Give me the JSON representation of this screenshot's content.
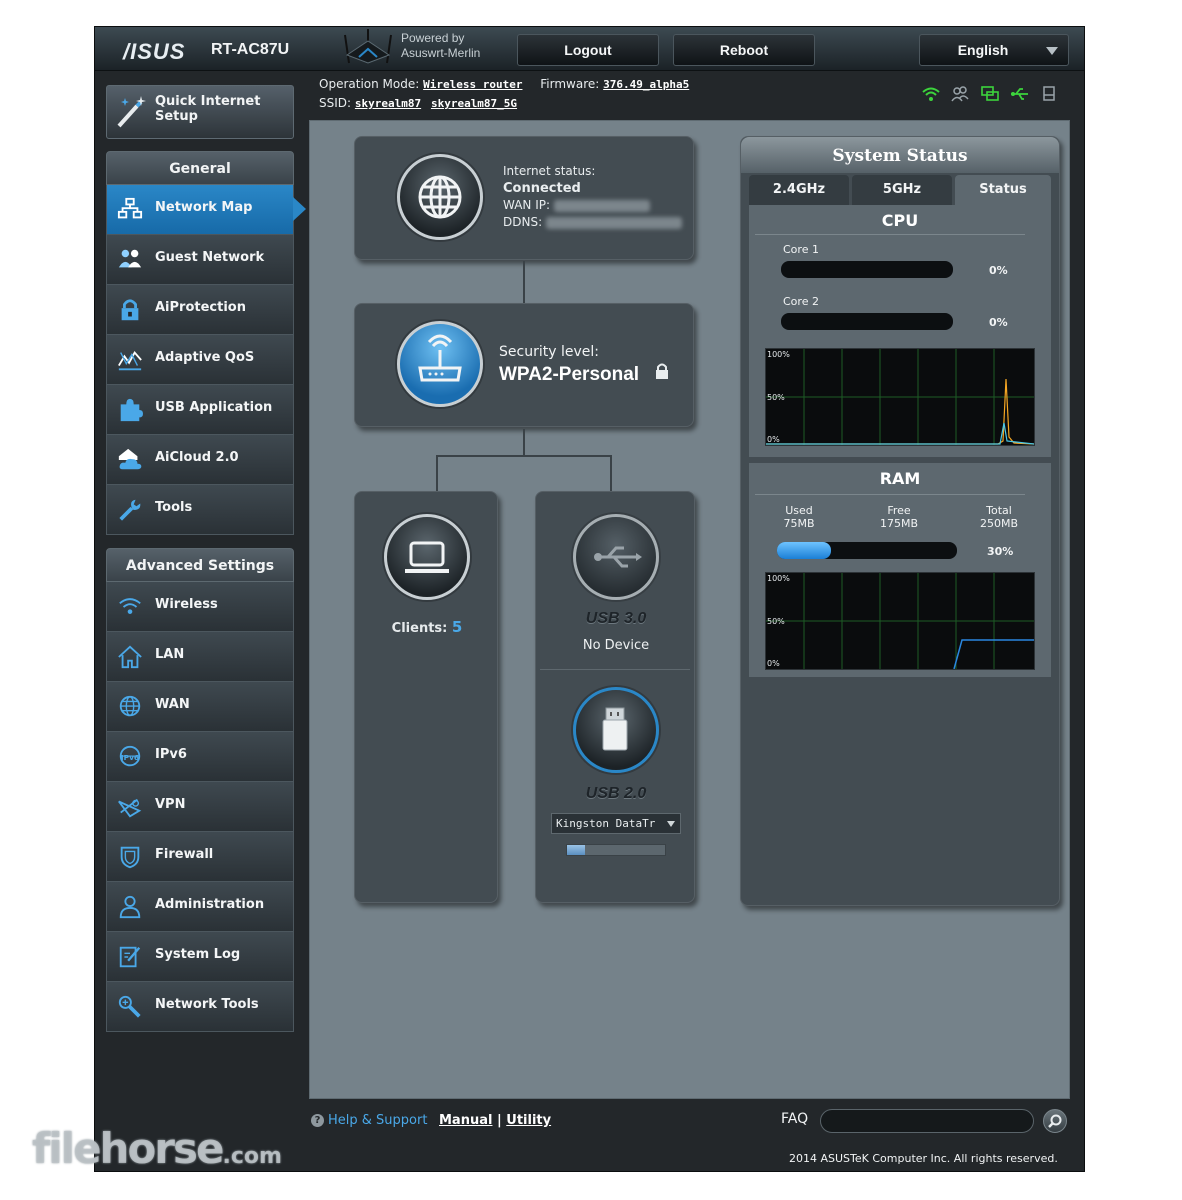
{
  "header": {
    "brand": "/ISUS",
    "model": "RT-AC87U",
    "powered_by": "Powered by",
    "firmware_name": "Asuswrt-Merlin",
    "logout_label": "Logout",
    "reboot_label": "Reboot",
    "language": "English"
  },
  "info": {
    "operation_mode_label": "Operation Mode:",
    "operation_mode": "Wireless router",
    "firmware_label": "Firmware:",
    "firmware": "376.49_alpha5",
    "ssid_label": "SSID:",
    "ssid_1": "skyrealm87",
    "ssid_2": "skyrealm87_5G"
  },
  "status_icons": [
    "wifi-icon",
    "clients-icon",
    "network-icon",
    "usb-icon",
    "printer-icon"
  ],
  "sidebar": {
    "quick_setup": "Quick Internet Setup",
    "general_title": "General",
    "general_items": [
      {
        "label": "Network Map",
        "icon": "network-map-icon"
      },
      {
        "label": "Guest Network",
        "icon": "guest-network-icon"
      },
      {
        "label": "AiProtection",
        "icon": "lock-icon"
      },
      {
        "label": "Adaptive QoS",
        "icon": "qos-icon"
      },
      {
        "label": "USB Application",
        "icon": "puzzle-icon"
      },
      {
        "label": "AiCloud 2.0",
        "icon": "cloud-icon"
      },
      {
        "label": "Tools",
        "icon": "wrench-icon"
      }
    ],
    "advanced_title": "Advanced Settings",
    "advanced_items": [
      {
        "label": "Wireless",
        "icon": "wireless-icon"
      },
      {
        "label": "LAN",
        "icon": "home-icon"
      },
      {
        "label": "WAN",
        "icon": "globe-icon"
      },
      {
        "label": "IPv6",
        "icon": "ipv6-icon"
      },
      {
        "label": "VPN",
        "icon": "vpn-icon"
      },
      {
        "label": "Firewall",
        "icon": "shield-icon"
      },
      {
        "label": "Administration",
        "icon": "user-icon"
      },
      {
        "label": "System Log",
        "icon": "log-icon"
      },
      {
        "label": "Network Tools",
        "icon": "tools-icon"
      }
    ]
  },
  "network_map": {
    "internet_status_label": "Internet status:",
    "internet_status": "Connected",
    "wan_ip_label": "WAN IP:",
    "ddns_label": "DDNS:",
    "security_label": "Security level:",
    "security_value": "WPA2-Personal",
    "clients_label": "Clients:",
    "clients_count": "5",
    "usb3_title": "USB 3.0",
    "usb3_status": "No Device",
    "usb2_title": "USB 2.0",
    "usb2_device": "Kingston DataTr",
    "usb2_usage_fraction": 0.18
  },
  "system_status": {
    "title": "System Status",
    "tabs": [
      "2.4GHz",
      "5GHz",
      "Status"
    ],
    "cpu_title": "CPU",
    "cores": [
      {
        "label": "Core 1",
        "percent": "0%",
        "fraction": 0
      },
      {
        "label": "Core 2",
        "percent": "0%",
        "fraction": 0
      }
    ],
    "graph_labels": [
      "100%",
      "50%",
      "0%"
    ],
    "ram_title": "RAM",
    "ram": {
      "used_label": "Used",
      "used": "75MB",
      "free_label": "Free",
      "free": "175MB",
      "total_label": "Total",
      "total": "250MB",
      "percent": "30%",
      "fraction": 0.3
    }
  },
  "footer": {
    "help_label": "Help & Support",
    "manual_label": "Manual",
    "separator": "|",
    "utility_label": "Utility",
    "faq_label": "FAQ",
    "copyright": "2014 ASUSTeK Computer Inc. All rights reserved."
  },
  "watermark": {
    "main": "filehorse",
    "suffix": ".com"
  },
  "colors": {
    "accent": "#2a87c7",
    "link": "#4aa8e8",
    "status_green": "#3cd43c"
  }
}
